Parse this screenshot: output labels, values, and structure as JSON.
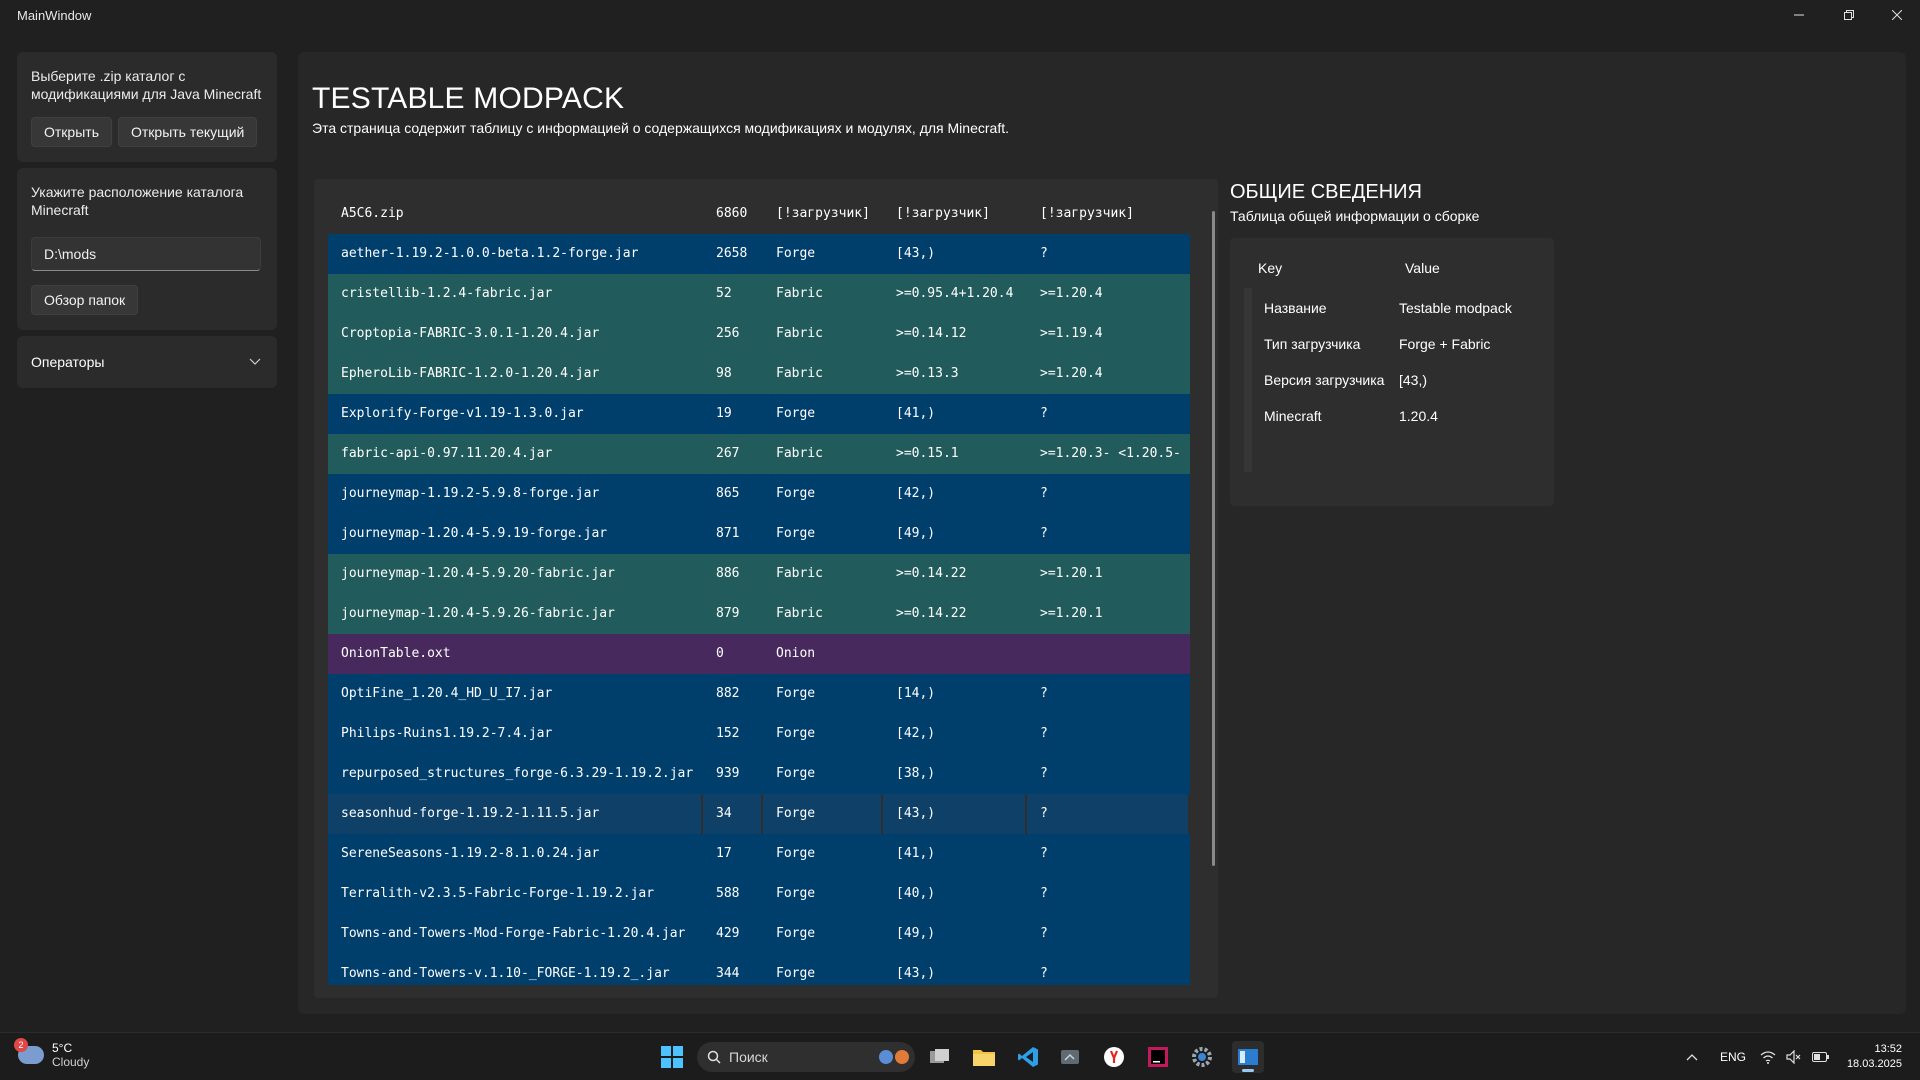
{
  "window": {
    "title": "MainWindow"
  },
  "nav": {
    "zip_desc": "Выберите .zip каталог с модификациями для Java Minecraft",
    "open_label": "Открыть",
    "open_current_label": "Открыть текущий",
    "location_desc": "Укажите расположение каталога Minecraft",
    "path_value": "D:\\mods",
    "browse_label": "Обзор папок",
    "operators_label": "Операторы"
  },
  "page": {
    "title": "TESTABLE MODPACK",
    "subtitle": "Эта страница содержит таблицу с информацией о содержащихся модификациях и модулях, для Minecraft."
  },
  "table": {
    "header": [
      "A5C6.zip",
      "6860",
      "[!загрузчик]",
      "[!загрузчик]",
      "[!загрузчик]"
    ],
    "rows": [
      {
        "name": "aether-1.19.2-1.0.0-beta.1.2-forge.jar",
        "size": "2658",
        "loader": "Forge",
        "loader_ver": "[43,)",
        "mc": "?",
        "kind": "forge"
      },
      {
        "name": "cristellib-1.2.4-fabric.jar",
        "size": "52",
        "loader": "Fabric",
        "loader_ver": ">=0.95.4+1.20.4",
        "mc": ">=1.20.4",
        "kind": "fabric"
      },
      {
        "name": "Croptopia-FABRIC-3.0.1-1.20.4.jar",
        "size": "256",
        "loader": "Fabric",
        "loader_ver": ">=0.14.12",
        "mc": ">=1.19.4",
        "kind": "fabric"
      },
      {
        "name": "EpheroLib-FABRIC-1.2.0-1.20.4.jar",
        "size": "98",
        "loader": "Fabric",
        "loader_ver": ">=0.13.3",
        "mc": ">=1.20.4",
        "kind": "fabric"
      },
      {
        "name": "Explorify-Forge-v1.19-1.3.0.jar",
        "size": "19",
        "loader": "Forge",
        "loader_ver": "[41,)",
        "mc": "?",
        "kind": "forge"
      },
      {
        "name": "fabric-api-0.97.11.20.4.jar",
        "size": "267",
        "loader": "Fabric",
        "loader_ver": ">=0.15.1",
        "mc": ">=1.20.3- <1.20.5-",
        "kind": "fabric"
      },
      {
        "name": "journeymap-1.19.2-5.9.8-forge.jar",
        "size": "865",
        "loader": "Forge",
        "loader_ver": "[42,)",
        "mc": "?",
        "kind": "forge"
      },
      {
        "name": "journeymap-1.20.4-5.9.19-forge.jar",
        "size": "871",
        "loader": "Forge",
        "loader_ver": "[49,)",
        "mc": "?",
        "kind": "forge"
      },
      {
        "name": "journeymap-1.20.4-5.9.20-fabric.jar",
        "size": "886",
        "loader": "Fabric",
        "loader_ver": ">=0.14.22",
        "mc": ">=1.20.1",
        "kind": "fabric"
      },
      {
        "name": "journeymap-1.20.4-5.9.26-fabric.jar",
        "size": "879",
        "loader": "Fabric",
        "loader_ver": ">=0.14.22",
        "mc": ">=1.20.1",
        "kind": "fabric"
      },
      {
        "name": "OnionTable.oxt",
        "size": "0",
        "loader": "Onion",
        "loader_ver": "",
        "mc": "",
        "kind": "onion"
      },
      {
        "name": "OptiFine_1.20.4_HD_U_I7.jar",
        "size": "882",
        "loader": "Forge",
        "loader_ver": "[14,)",
        "mc": "?",
        "kind": "forge"
      },
      {
        "name": "Philips-Ruins1.19.2-7.4.jar",
        "size": "152",
        "loader": "Forge",
        "loader_ver": "[42,)",
        "mc": "?",
        "kind": "forge"
      },
      {
        "name": "repurposed_structures_forge-6.3.29-1.19.2.jar",
        "size": "939",
        "loader": "Forge",
        "loader_ver": "[38,)",
        "mc": "?",
        "kind": "forge"
      },
      {
        "name": "seasonhud-forge-1.19.2-1.11.5.jar",
        "size": "34",
        "loader": "Forge",
        "loader_ver": "[43,)",
        "mc": "?",
        "kind": "selected"
      },
      {
        "name": "SereneSeasons-1.19.2-8.1.0.24.jar",
        "size": "17",
        "loader": "Forge",
        "loader_ver": "[41,)",
        "mc": "?",
        "kind": "forge"
      },
      {
        "name": "Terralith-v2.3.5-Fabric-Forge-1.19.2.jar",
        "size": "588",
        "loader": "Forge",
        "loader_ver": "[40,)",
        "mc": "?",
        "kind": "forge"
      },
      {
        "name": "Towns-and-Towers-Mod-Forge-Fabric-1.20.4.jar",
        "size": "429",
        "loader": "Forge",
        "loader_ver": "[49,)",
        "mc": "?",
        "kind": "forge"
      },
      {
        "name": "Towns-and-Towers-v.1.10-_FORGE-1.19.2_.jar",
        "size": "344",
        "loader": "Forge",
        "loader_ver": "[43,)",
        "mc": "?",
        "kind": "forge"
      }
    ]
  },
  "info": {
    "title": "ОБЩИЕ СВЕДЕНИЯ",
    "subtitle": "Таблица общей информации о сборке",
    "key_header": "Key",
    "value_header": "Value",
    "rows": [
      {
        "k": "Название",
        "v": "Testable modpack"
      },
      {
        "k": "Тип загрузчика",
        "v": "Forge + Fabric"
      },
      {
        "k": "Версия загрузчика",
        "v": "[43,)"
      },
      {
        "k": "Minecraft",
        "v": "1.20.4"
      },
      {
        "k": "",
        "v": ""
      }
    ]
  },
  "taskbar": {
    "weather_temp": "5°C",
    "weather_cond": "Cloudy",
    "weather_badge": "2",
    "search_label": "Поиск",
    "lang": "ENG",
    "time": "13:52",
    "date": "18.03.2025"
  },
  "colors": {
    "forge_row": "#003e6b",
    "fabric_row": "#225b5b",
    "onion_row": "#48295d",
    "background": "#202020"
  }
}
